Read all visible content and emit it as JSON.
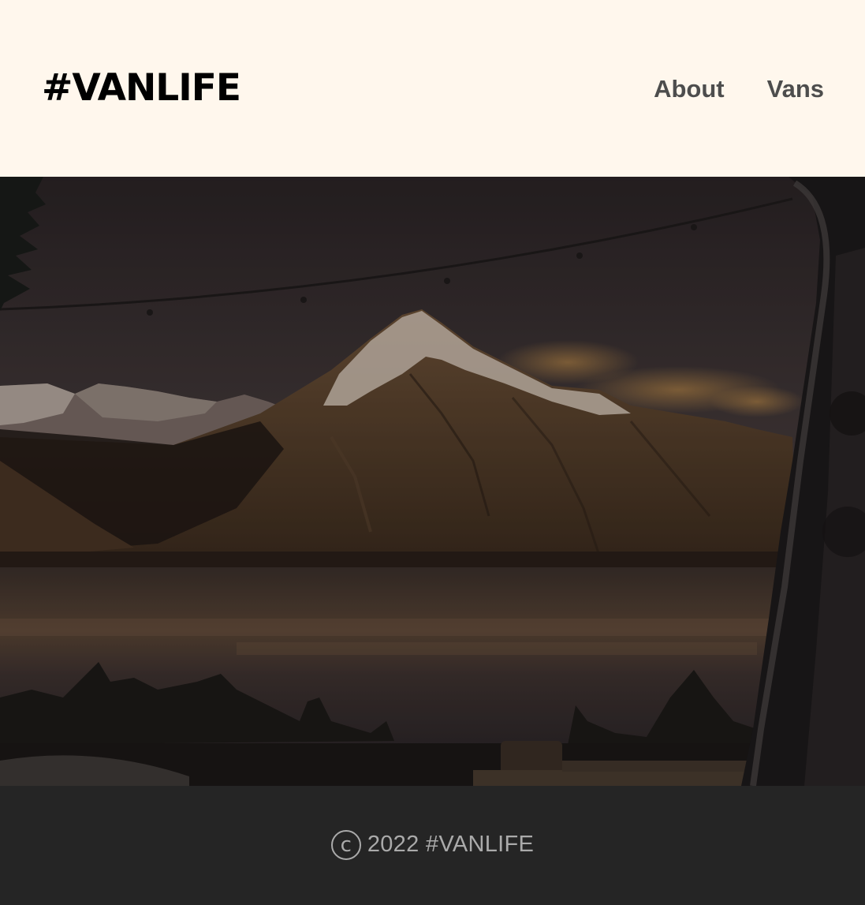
{
  "header": {
    "logo": "#VANLIFE",
    "nav": [
      {
        "label": "About"
      },
      {
        "label": "Vans"
      }
    ]
  },
  "hero": {
    "image": "mountain-lake-through-van-window"
  },
  "footer": {
    "icon": "copyright-icon",
    "text": "2022 #VANLIFE"
  },
  "colors": {
    "header_bg": "#FFF7ED",
    "logo": "#000000",
    "nav": "#4D4D4D",
    "footer_bg": "#252525",
    "footer_text": "#AAAAAA"
  }
}
